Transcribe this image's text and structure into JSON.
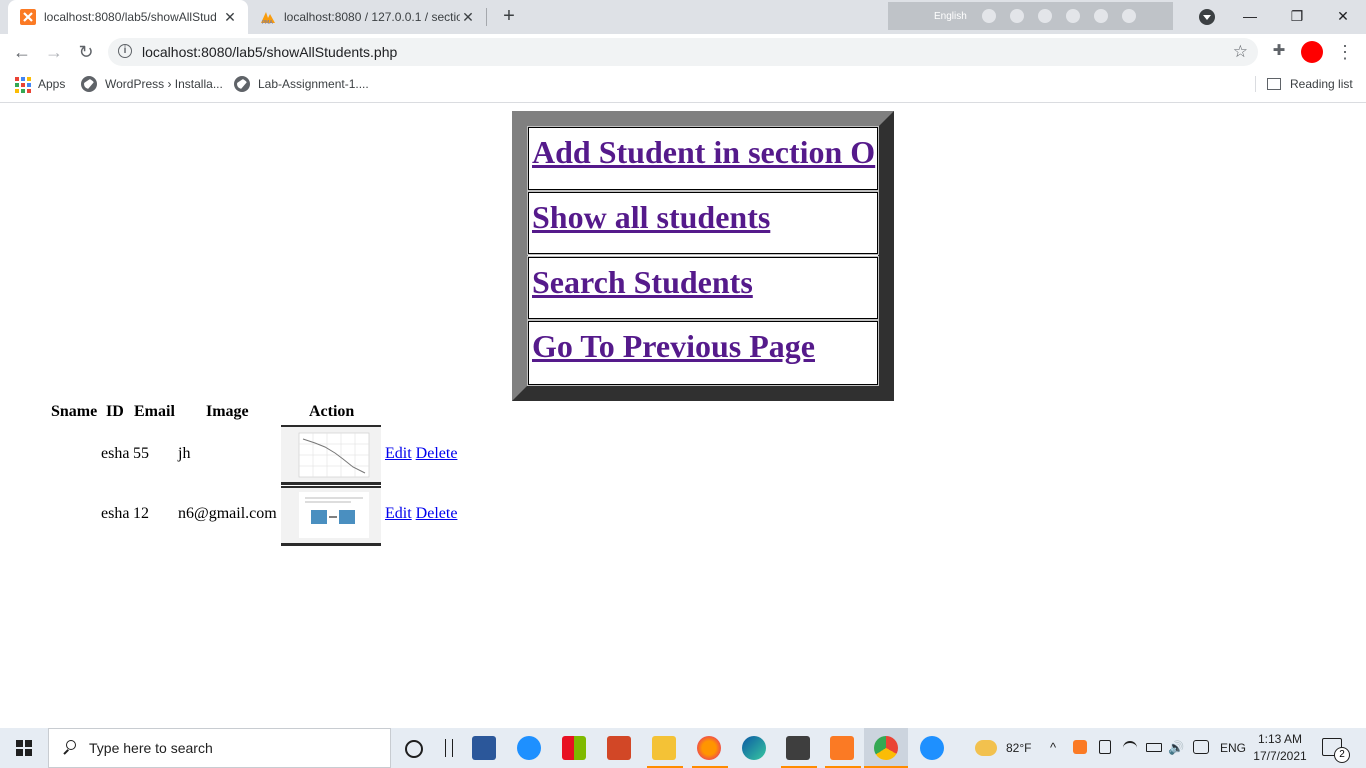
{
  "browser": {
    "tabs": [
      {
        "title": "localhost:8080/lab5/showAllStud",
        "active": true
      },
      {
        "title": "localhost:8080 / 127.0.0.1 / sectio",
        "active": false
      }
    ],
    "ime": {
      "language": "English"
    },
    "url": "localhost:8080/lab5/showAllStudents.php",
    "bookmarks": [
      {
        "label": "Apps"
      },
      {
        "label": "WordPress › Installa..."
      },
      {
        "label": "Lab-Assignment-1...."
      }
    ],
    "reading_list": "Reading list"
  },
  "page": {
    "menu": [
      {
        "label": "Add Student in section O"
      },
      {
        "label": "Show all students"
      },
      {
        "label": "Search Students"
      },
      {
        "label": "Go To Previous Page"
      }
    ],
    "table": {
      "headers": [
        "Sname",
        "ID",
        "Email",
        "Image",
        "Action"
      ],
      "rows": [
        {
          "sname": "esha",
          "id": "55",
          "email": "jh",
          "edit": "Edit",
          "delete": "Delete"
        },
        {
          "sname": "esha",
          "id": "12",
          "email": "n6@gmail.com",
          "edit": "Edit",
          "delete": "Delete"
        }
      ]
    },
    "link_color": "#0000ee",
    "visited_color": "#551a8b"
  },
  "taskbar": {
    "search_placeholder": "Type here to search",
    "weather": "82°F",
    "language": "ENG",
    "time": "1:13 AM",
    "date": "17/7/2021",
    "notifications": "2"
  }
}
